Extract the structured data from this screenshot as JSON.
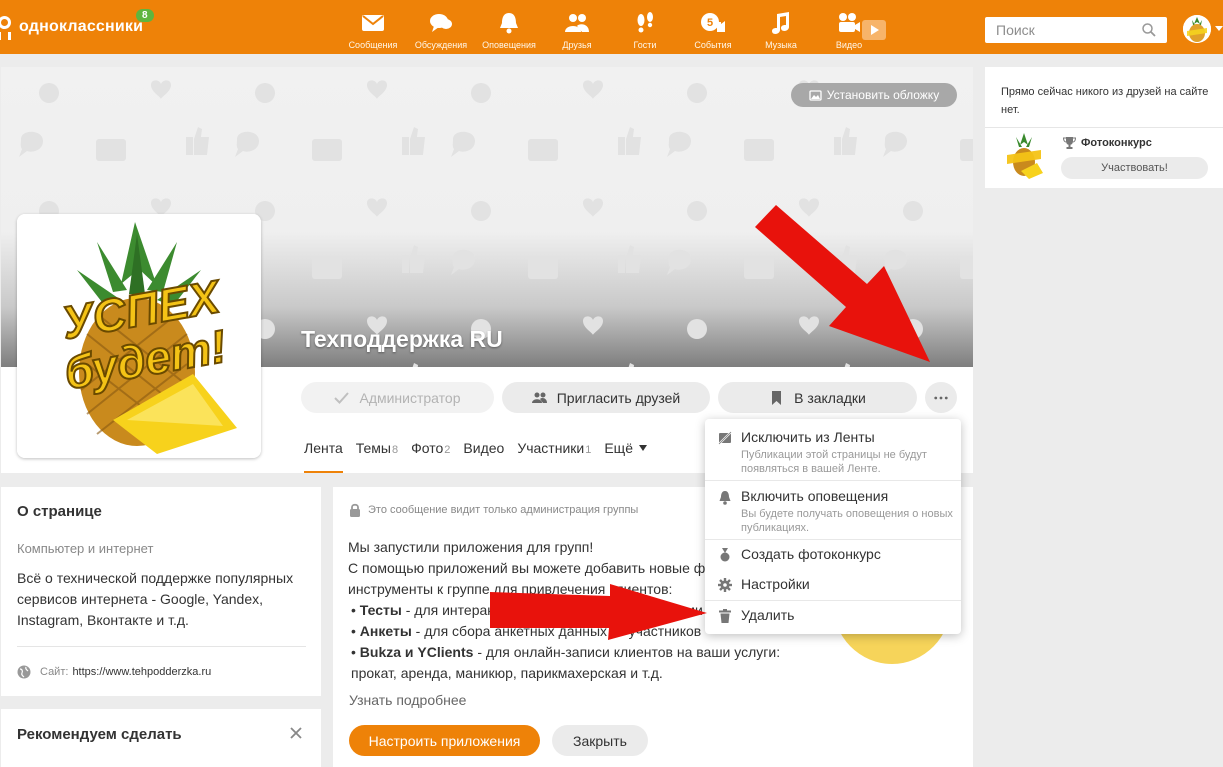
{
  "header": {
    "logo_text": "одноклассники",
    "logo_badge": "8",
    "nav": [
      {
        "label": "Сообщения",
        "icon": "envelope-icon"
      },
      {
        "label": "Обсуждения",
        "icon": "chat-bubbles-icon"
      },
      {
        "label": "Оповещения",
        "icon": "bell-icon"
      },
      {
        "label": "Друзья",
        "icon": "people-icon"
      },
      {
        "label": "Гости",
        "icon": "footprints-icon"
      },
      {
        "label": "События",
        "icon": "events-icon"
      },
      {
        "label": "Музыка",
        "icon": "music-note-icon"
      },
      {
        "label": "Видео",
        "icon": "video-camera-icon"
      }
    ],
    "events_badge": "5",
    "search_placeholder": "Поиск"
  },
  "cover": {
    "set_cover_label": "Установить обложку"
  },
  "group": {
    "title": "Техподдержка RU",
    "avatar_text": [
      "УСПЕХ",
      "будет!"
    ]
  },
  "actions": {
    "admin_label": "Администратор",
    "invite_label": "Пригласить друзей",
    "bookmark_label": "В закладки"
  },
  "tabs": [
    {
      "label": "Лента",
      "count": ""
    },
    {
      "label": "Темы",
      "count": "8"
    },
    {
      "label": "Фото",
      "count": "2"
    },
    {
      "label": "Видео",
      "count": ""
    },
    {
      "label": "Участники",
      "count": "1"
    },
    {
      "label": "Ещё",
      "count": ""
    }
  ],
  "about": {
    "title": "О странице",
    "category": "Компьютер и интернет",
    "description": "Всё о технической поддержке популярных сервисов интернета - Google, Yandex, Instagram, Вконтакте и т.д.",
    "site_label": "Сайт:",
    "site_url": "https://www.tehpodderzka.ru"
  },
  "recommend": {
    "title": "Рекомендуем сделать"
  },
  "post": {
    "note": "Это сообщение видит только администрация группы",
    "line1": "Мы запустили приложения для групп!",
    "line2": "С помощью приложений вы можете добавить новые функции и",
    "line3": "инструменты к группе для привлечения клиентов:",
    "item1_bold": "Тесты",
    "item1_text": " - для интерактивного общения с участниками",
    "item2_bold": "Анкеты",
    "item2_text": " - для сбора анкетных данных от участников",
    "item3_bold": "Bukza и YClients",
    "item3_text": " - для онлайн-записи клиентов на ваши услуги:",
    "item3_cont": "прокат, аренда, маникюр, парикмахерская и т.д.",
    "more_link": "Узнать подробнее",
    "setup_label": "Настроить приложения",
    "close_label": "Закрыть"
  },
  "menu": {
    "exclude_label": "Исключить из Ленты",
    "exclude_sub": "Публикации этой страницы не будут появляться в вашей Ленте.",
    "notify_label": "Включить оповещения",
    "notify_sub": "Вы будете получать оповещения о новых публикациях.",
    "contest_label": "Создать фотоконкурс",
    "settings_label": "Настройки",
    "delete_label": "Удалить"
  },
  "sidebar": {
    "friends_text": "Прямо сейчас никого из друзей на сайте нет.",
    "contest_title": "Фотоконкурс",
    "contest_btn": "Участвовать!"
  },
  "colors": {
    "brand_orange": "#ee8208",
    "arrow_red": "#e8120c"
  }
}
